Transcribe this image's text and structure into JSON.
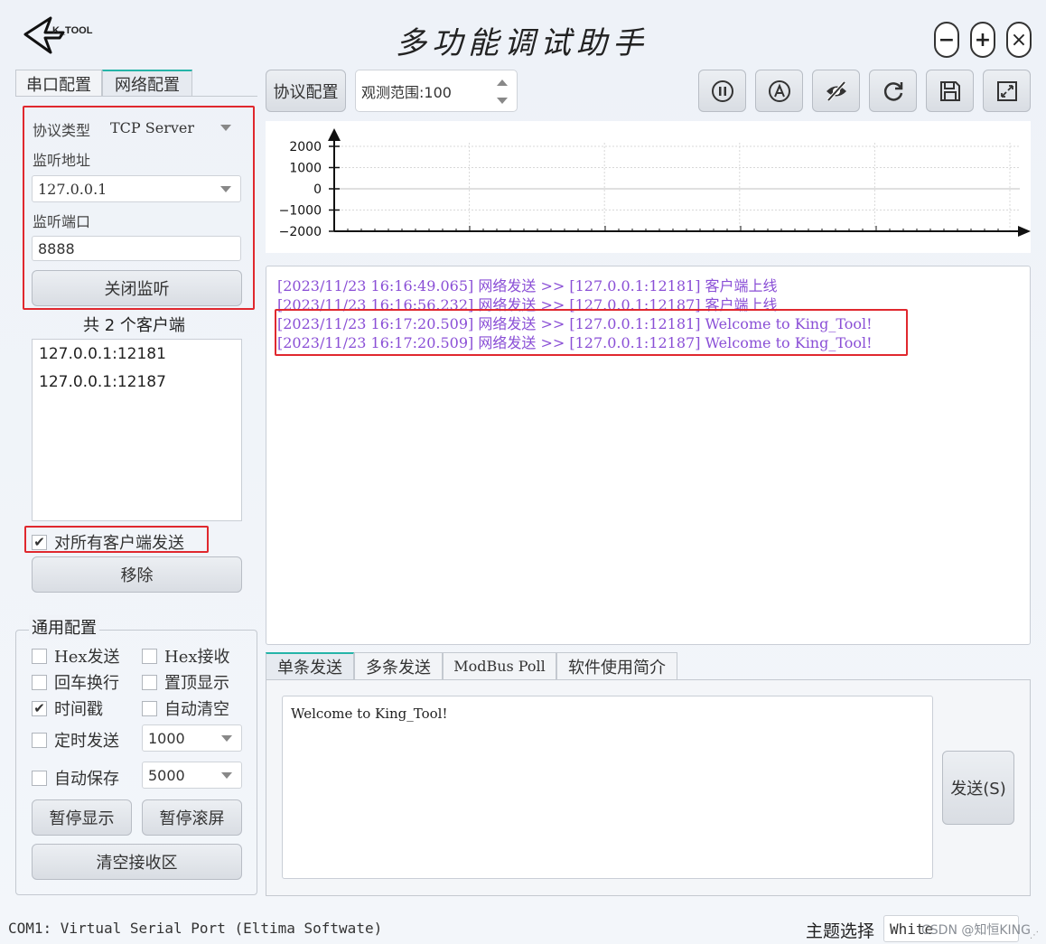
{
  "app": {
    "logo_text": "K_TOOL",
    "title": "多功能调试助手",
    "window_controls": {
      "minimize": "−",
      "maximize": "+",
      "close": "×"
    }
  },
  "left_tabs": [
    "串口配置",
    "网络配置"
  ],
  "network": {
    "protocol_label": "协议类型",
    "protocol_value": "TCP Server",
    "listen_addr_label": "监听地址",
    "listen_addr_value": "127.0.0.1",
    "listen_port_label": "监听端口",
    "listen_port_value": "8888",
    "close_listen_button": "关闭监听",
    "client_count_text": "共 2 个客户端",
    "clients": [
      "127.0.0.1:12181",
      "127.0.0.1:12187"
    ],
    "send_all_label": "对所有客户端发送",
    "send_all_checked": true,
    "remove_button": "移除"
  },
  "general": {
    "group_title": "通用配置",
    "hex_send": "Hex发送",
    "hex_recv": "Hex接收",
    "newline": "回车换行",
    "top_display": "置顶显示",
    "timestamp": "时间戳",
    "timestamp_checked": true,
    "auto_clear": "自动清空",
    "timed_send": "定时发送",
    "timed_send_value": "1000",
    "auto_save": "自动保存",
    "auto_save_value": "5000",
    "pause_display": "暂停显示",
    "pause_scroll": "暂停滚屏",
    "clear_recv": "清空接收区"
  },
  "toolbar": {
    "protocol_config": "协议配置",
    "observe_range": "观测范围:100"
  },
  "chart_data": {
    "type": "line",
    "x": [],
    "series": [],
    "y_ticks": [
      "2000",
      "1000",
      "0",
      "−1000",
      "−2000"
    ],
    "ylim": [
      -2000,
      2000
    ],
    "grid": true
  },
  "log": [
    "[2023/11/23 16:16:49.065] 网络发送 >> [127.0.0.1:12181] 客户端上线",
    "[2023/11/23 16:16:56.232] 网络发送 >> [127.0.0.1:12187] 客户端上线",
    "[2023/11/23 16:17:20.509] 网络发送 >> [127.0.0.1:12181] Welcome to King_Tool!",
    "[2023/11/23 16:17:20.509] 网络发送 >> [127.0.0.1:12187] Welcome to King_Tool!"
  ],
  "send_tabs": [
    "单条发送",
    "多条发送",
    "ModBus Poll",
    "软件使用简介"
  ],
  "send": {
    "text": "Welcome to King_Tool!",
    "button": "发送(S)"
  },
  "status": {
    "port_text": "COM1: Virtual Serial Port (Eltima Softwate)",
    "theme_label": "主题选择",
    "theme_value": "White",
    "watermark": "CSDN @知恒KING"
  },
  "colors": {
    "accent": "#25b4a8",
    "highlight_box": "#e0282e",
    "log_text": "#8a4fd6"
  }
}
